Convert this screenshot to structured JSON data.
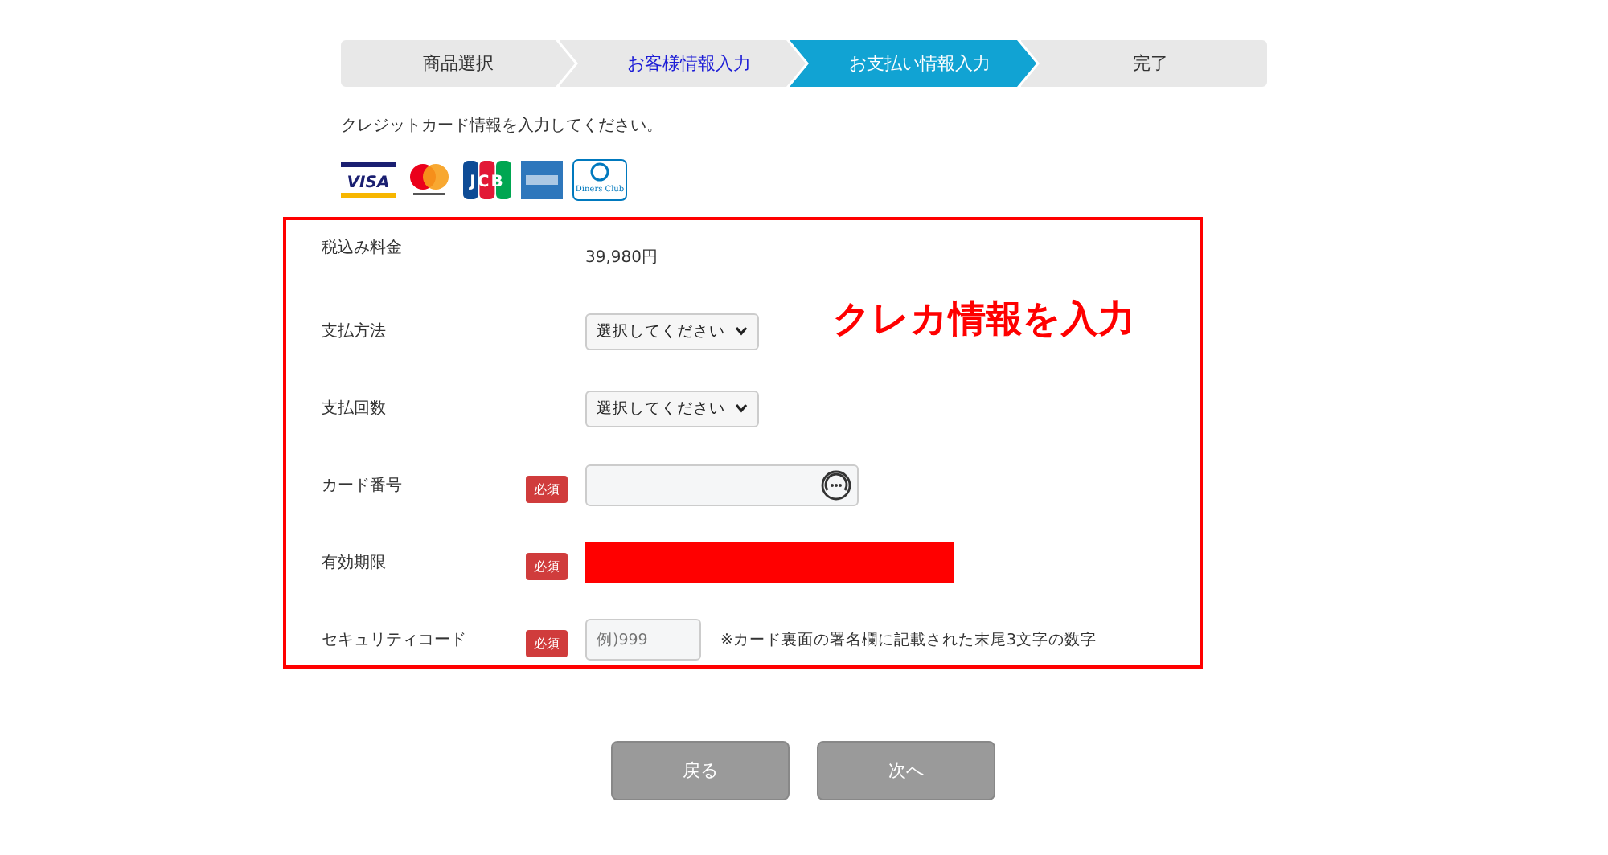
{
  "steps": [
    {
      "label": "商品選択",
      "selected": false,
      "link": false
    },
    {
      "label": "お客様情報入力",
      "selected": false,
      "link": true
    },
    {
      "label": "お支払い情報入力",
      "selected": true,
      "link": false
    },
    {
      "label": "完了",
      "selected": false,
      "link": false
    }
  ],
  "instruction": "クレジットカード情報を入力してください。",
  "cards": [
    {
      "kind": "visa",
      "label": "VISA"
    },
    {
      "kind": "mastercard"
    },
    {
      "kind": "jcb",
      "label": "JCB"
    },
    {
      "kind": "amex"
    },
    {
      "kind": "diners",
      "label": "Diners Club"
    }
  ],
  "annotation": "クレカ情報を入力",
  "rows": [
    {
      "kind": "text",
      "label": "税込み料金",
      "value": "39,980円"
    },
    {
      "kind": "select",
      "label": "支払方法",
      "value": "選択してください"
    },
    {
      "kind": "select",
      "label": "支払回数",
      "value": "選択してください"
    },
    {
      "kind": "card_input",
      "label": "カード番号",
      "badge": "必須"
    },
    {
      "kind": "redacted",
      "label": "有効期限",
      "badge": "必須"
    },
    {
      "kind": "short_input",
      "label": "セキュリティコード",
      "badge": "必須",
      "placeholder": "例)999",
      "note": "※カード裏面の署名欄に記載された末尾3文字の数字"
    }
  ],
  "buttons": [
    "戻る",
    "次へ"
  ]
}
